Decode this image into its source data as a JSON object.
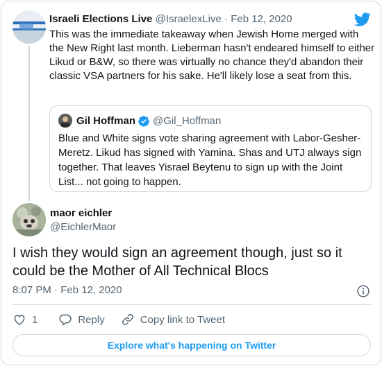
{
  "parent": {
    "name": "Israeli Elections Live",
    "handle": "@IsraelexLive",
    "separator": "·",
    "date": "Feb 12, 2020",
    "text": "This was the immediate takeaway when Jewish Home merged with the New Right last month. Lieberman hasn't endeared himself to either Likud or B&W, so there was virtually no chance they'd abandon their classic VSA partners for his sake. He'll likely lose a seat from this."
  },
  "quote": {
    "name": "Gil Hoffman",
    "handle": "@Gil_Hoffman",
    "text": "Blue and White signs vote sharing agreement with Labor-Gesher-Meretz. Likud has signed with Yamina. Shas and UTJ always sign together. That leaves Yisrael Beytenu to sign up with the Joint List... not going to happen."
  },
  "main": {
    "name": "maor eichler",
    "handle": "@EichlerMaor",
    "text": "I wish they would sign an agreement though, just so it could be the Mother of All Technical Blocs",
    "time": "8:07 PM",
    "separator": "·",
    "date": "Feb 12, 2020"
  },
  "actions": {
    "like_count": "1",
    "reply_label": "Reply",
    "copy_label": "Copy link to Tweet"
  },
  "explore_label": "Explore what's happening on Twitter",
  "colors": {
    "accent": "#1d9bf0",
    "muted": "#536471",
    "border": "#cfd9de",
    "text": "#0f1419"
  }
}
